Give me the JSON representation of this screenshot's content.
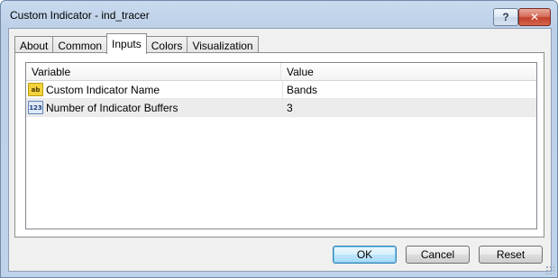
{
  "window": {
    "title": "Custom Indicator - ind_tracer",
    "help_label": "?",
    "close_label": "✕"
  },
  "tabs": [
    {
      "label": "About",
      "active": false
    },
    {
      "label": "Common",
      "active": false
    },
    {
      "label": "Inputs",
      "active": true
    },
    {
      "label": "Colors",
      "active": false
    },
    {
      "label": "Visualization",
      "active": false
    }
  ],
  "table": {
    "columns": [
      "Variable",
      "Value"
    ],
    "rows": [
      {
        "icon": "string-type-icon",
        "icon_text": "ab",
        "variable": "Custom Indicator Name",
        "value": "Bands"
      },
      {
        "icon": "integer-type-icon",
        "icon_text": "123",
        "variable": "Number of Indicator Buffers",
        "value": "3"
      }
    ]
  },
  "buttons": {
    "ok": "OK",
    "cancel": "Cancel",
    "reset": "Reset"
  },
  "colors": {
    "window_frame": "#bcd0e8",
    "ok_accent": "#3c7fb1",
    "close_red": "#c2402b",
    "string_icon": "#f4d23a",
    "int_icon": "#5a80b7"
  }
}
